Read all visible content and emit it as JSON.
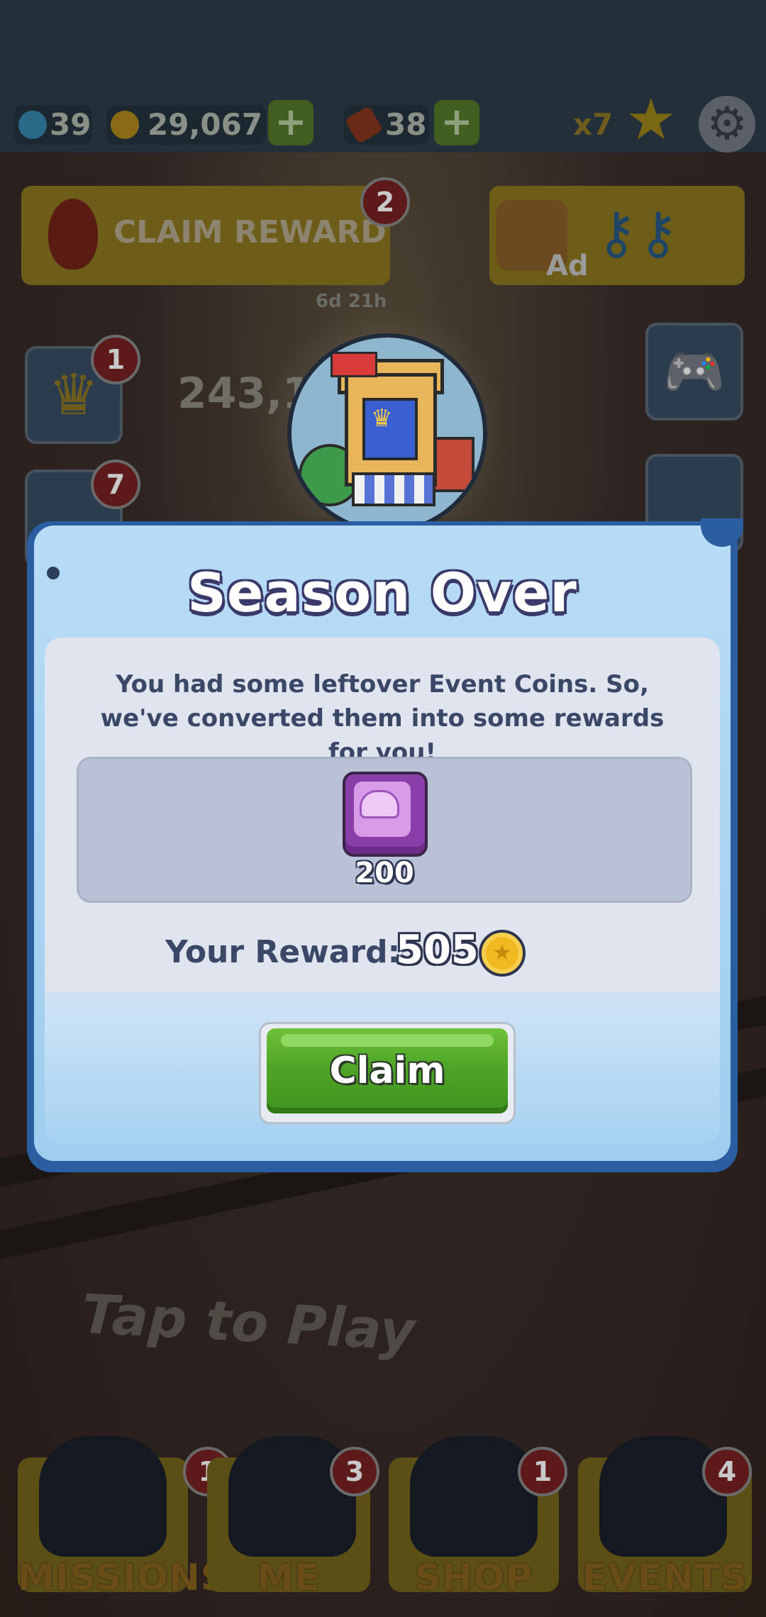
{
  "hud": {
    "keys": "39",
    "coins": "29,067",
    "boards": "38",
    "multiplier": "x7",
    "plus_symbol": "+"
  },
  "home": {
    "claim_reward_label": "CLAIM REWARD",
    "claim_reward_badge": "2",
    "timer": "6d 21h",
    "ad_label": "Ad",
    "crown_badge": "1",
    "news_badge": "7",
    "score_partial": "243,1",
    "tap_to_play": "Tap to Play"
  },
  "nav": [
    {
      "label": "MISSIONS",
      "badge": "1"
    },
    {
      "label": "ME",
      "badge": "3"
    },
    {
      "label": "SHOP",
      "badge": "1"
    },
    {
      "label": "EVENTS",
      "badge": "4"
    }
  ],
  "modal": {
    "title": "Season Over",
    "message": "You had some leftover Event Coins. So, we've converted them into some rewards for you!",
    "item_count": "200",
    "your_reward_label": "Your Reward:",
    "your_reward_value": "505",
    "claim_label": "Claim"
  },
  "colors": {
    "modal_border": "#2b5ea0",
    "claim_green": "#4fa526",
    "token_purple": "#8a3fa8",
    "coin_gold": "#f1b91f"
  }
}
